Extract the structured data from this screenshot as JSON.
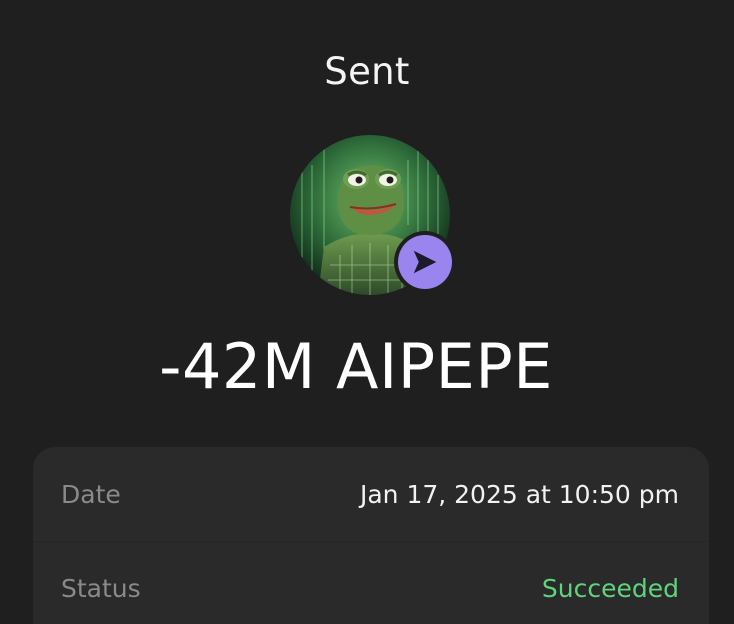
{
  "header": {
    "title": "Sent"
  },
  "token": {
    "icon": "aipepe-token-avatar",
    "badge_icon": "send-arrow-icon",
    "badge_color": "#9a84ee"
  },
  "amount": {
    "text": "-42M AIPEPE"
  },
  "details": {
    "rows": [
      {
        "label": "Date",
        "value": "Jan 17, 2025 at 10:50 pm"
      },
      {
        "label": "Status",
        "value": "Succeeded",
        "value_color": "#5fd37e"
      }
    ]
  },
  "colors": {
    "background": "#1f1f1f",
    "card": "#2a2a2a",
    "label": "#8a8a8a",
    "success": "#5fd37e"
  }
}
